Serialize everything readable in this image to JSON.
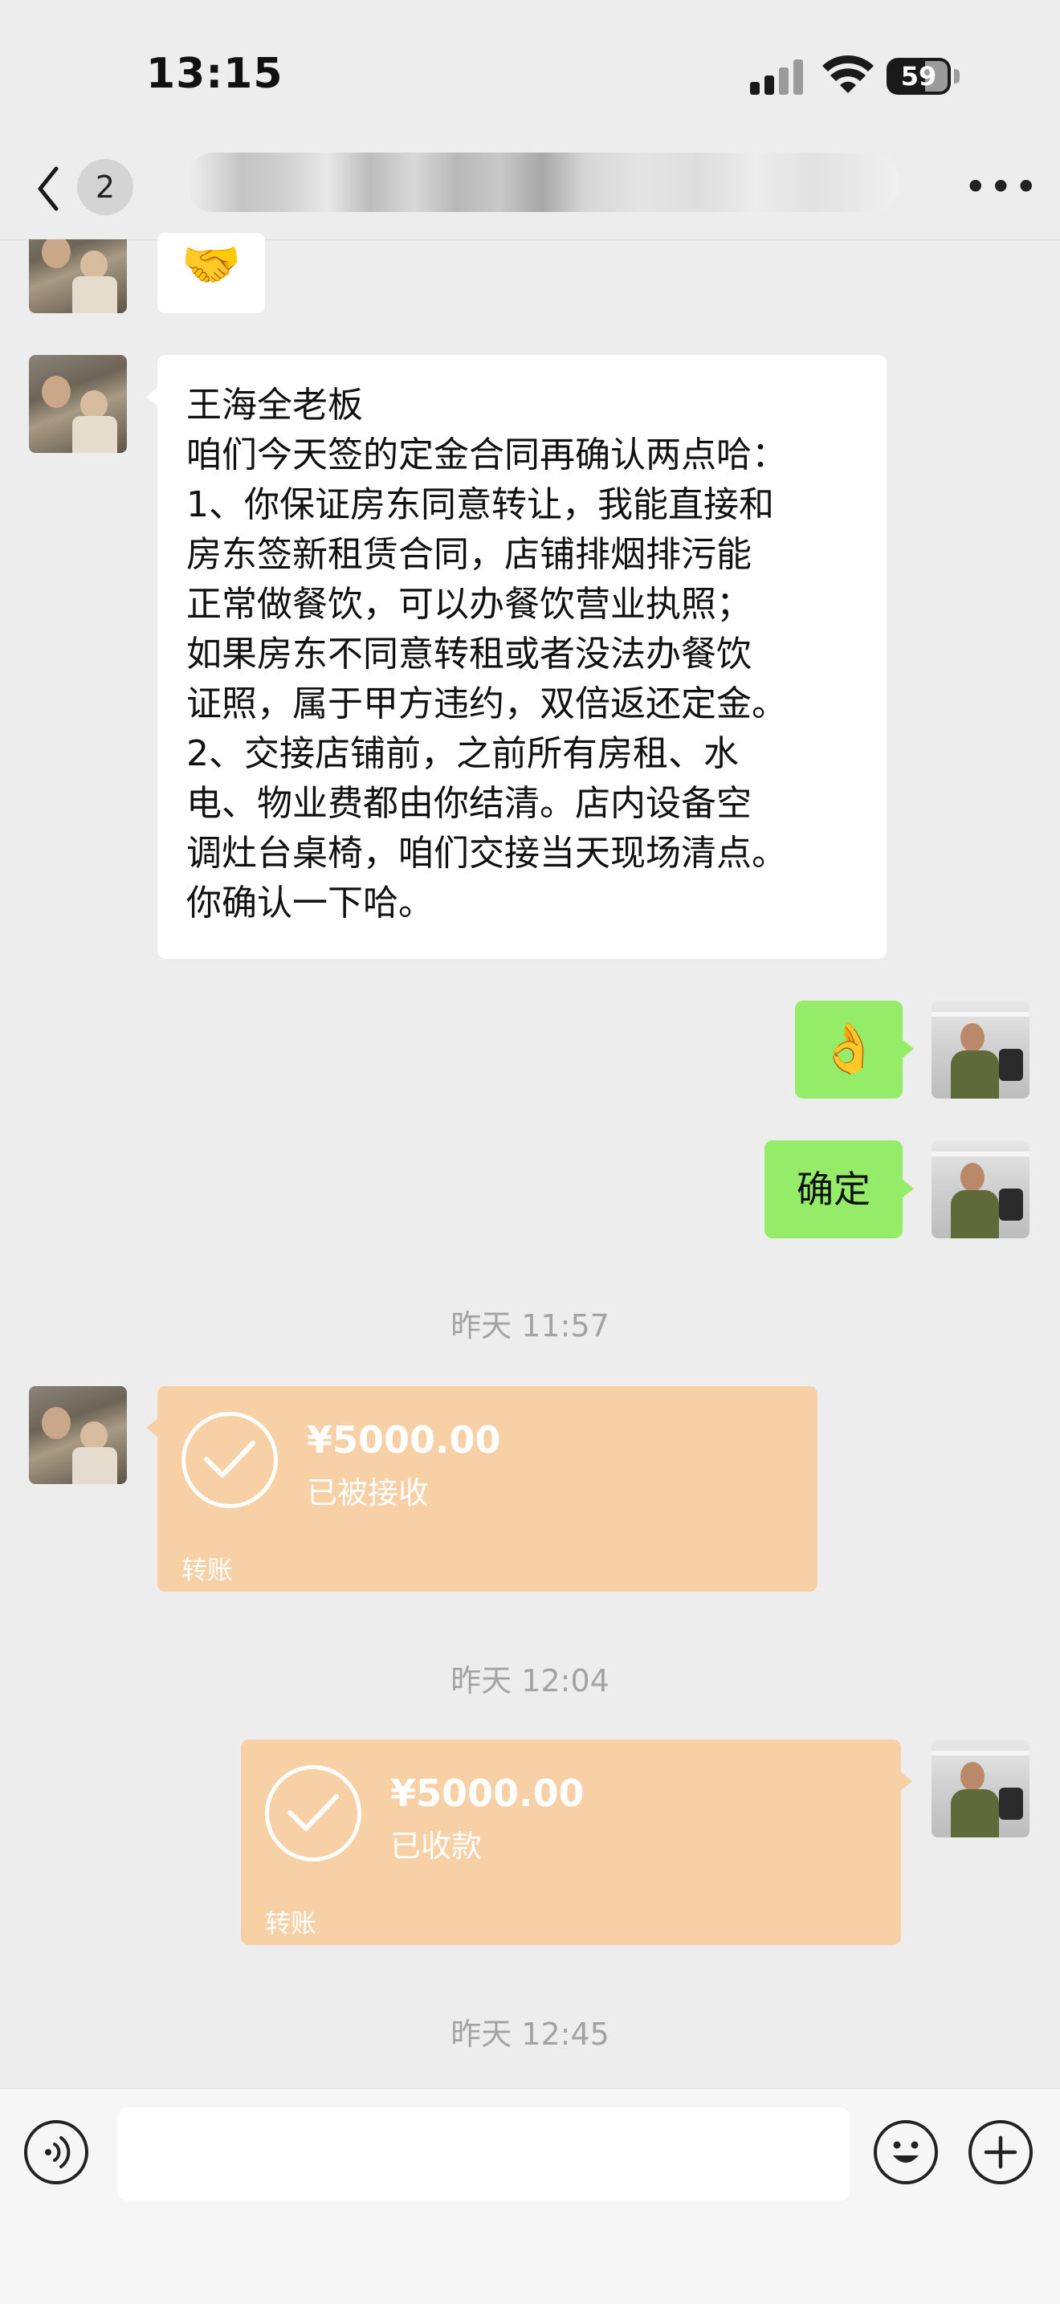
{
  "status_bar": {
    "time": "13:15",
    "battery": "59"
  },
  "nav": {
    "back_count": "2",
    "title": "790781770",
    "more_label": "•••"
  },
  "messages": [
    {
      "side": "left",
      "type": "emoji",
      "emoji": "🤝",
      "icon": "handshake-emoji"
    },
    {
      "side": "left",
      "type": "text",
      "text": "王海全老板\n咱们今天签的定金合同再确认两点哈：\n1、你保证房东同意转让，我能直接和\n房东签新租赁合同，店铺排烟排污能\n正常做餐饮，可以办餐饮营业执照；\n如果房东不同意转租或者没法办餐饮\n证照，属于甲方违约，双倍返还定金。\n2、交接店铺前，之前所有房租、水\n电、物业费都由你结清。店内设备空\n调灶台桌椅，咱们交接当天现场清点。\n你确认一下哈。"
    },
    {
      "side": "right",
      "type": "emoji",
      "emoji": "👌",
      "icon": "ok-hand-emoji"
    },
    {
      "side": "right",
      "type": "text",
      "text": "确定"
    }
  ],
  "timestamps": [
    "昨天 11:57",
    "昨天 12:04",
    "昨天 12:45"
  ],
  "transfers": [
    {
      "side": "left",
      "amount": "¥5000.00",
      "status": "已被接收",
      "label": "转账"
    },
    {
      "side": "right",
      "amount": "¥5000.00",
      "status": "已收款",
      "label": "转账"
    }
  ],
  "input_bar": {
    "placeholder": "",
    "voice_icon": "voice-icon",
    "emoji_icon": "smiley-icon",
    "plus_icon": "plus-icon"
  },
  "colors": {
    "background": "#ededed",
    "sent_bubble": "#95ec69",
    "received_bubble": "#ffffff",
    "transfer_card": "#f7d0a6"
  }
}
